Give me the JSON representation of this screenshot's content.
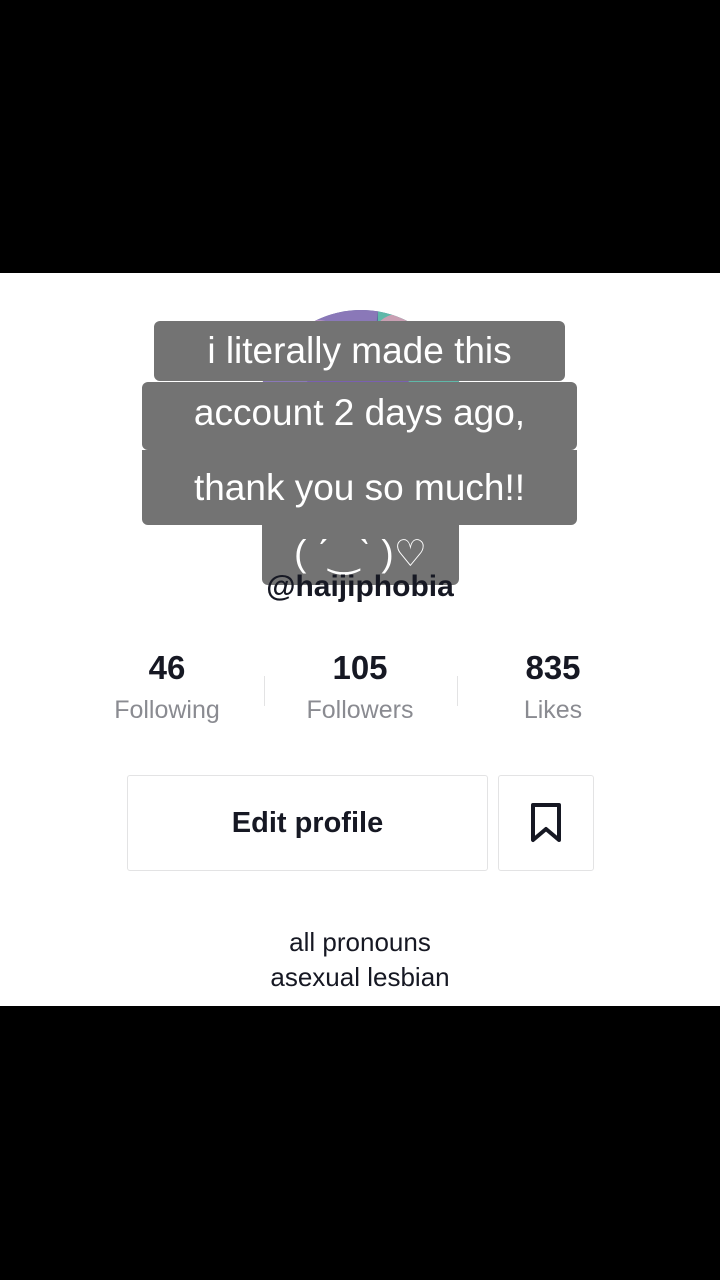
{
  "profile": {
    "username": "@haijiphobia",
    "stats": [
      {
        "count": "46",
        "label": "Following"
      },
      {
        "count": "105",
        "label": "Followers"
      },
      {
        "count": "835",
        "label": "Likes"
      }
    ],
    "edit_profile_label": "Edit profile",
    "bookmark_icon": "bookmark-icon",
    "bio": [
      "all pronouns",
      "asexual lesbian"
    ]
  },
  "caption": {
    "lines": [
      "i literally made this",
      "account 2 days ago,",
      "thank you so much!!",
      "( ˊ‿ˋ )♡"
    ]
  },
  "colors": {
    "caption_bg": "#737373",
    "text_primary": "#161823",
    "text_secondary": "#8a8b91",
    "border": "#e3e3e4"
  }
}
